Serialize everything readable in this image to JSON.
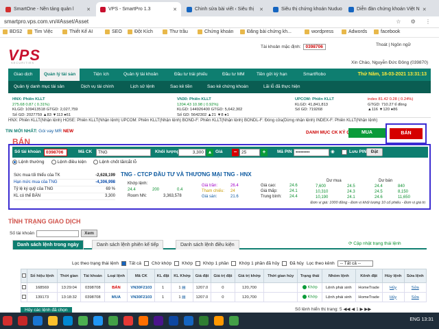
{
  "browser": {
    "tabs": [
      {
        "label": "SmartOne - Nền tảng quản l",
        "color": "#d32f2f"
      },
      {
        "label": "VPS - SmartPro 1.3",
        "color": "#c8102e"
      },
      {
        "label": "Chinh sửa bài viết ‹ Siêu thị",
        "color": "#1565c0"
      },
      {
        "label": "Siêu thị chứng khoán Nuduo",
        "color": "#1565c0"
      },
      {
        "label": "Diễn đàn chứng khoán Việt N",
        "color": "#1565c0"
      }
    ],
    "url": "smartpro.vps.com.vn/#Asset/Asset",
    "bookmarks": [
      "BDS2",
      "Tim Việc",
      "Thiết Kế AI",
      "SEO",
      "Đột Kích",
      "Thư trầu",
      "Chứng khoán",
      "Đăng bài chứng kh...",
      "wordpress",
      "Adwords",
      "facebook"
    ]
  },
  "header": {
    "logo": "VPS",
    "logo_sub": "SECURITIES",
    "account_label": "Tài khoản mặc định:",
    "account_value": "0398706",
    "links": "Thoát | Ngôn ngữ",
    "greeting": "Xin Chào, Nguyễn Đức Đông (039870)"
  },
  "menu1": {
    "items": [
      "Giao dịch",
      "Quản lý tài sản",
      "Tiện ích",
      "Quản lý tài khoản",
      "Đầu tư trái phiếu",
      "Đầu tư MM",
      "Tiền gửi kỳ hạn",
      "SmartRobo"
    ],
    "datetime": "Thứ Năm, 18-03-2021 13:31:13"
  },
  "menu2": {
    "items": [
      "Quản lý danh mục tài sản",
      "Dịch vụ tài chính",
      "Lịch sử lệnh",
      "Sao kê tiền",
      "Sao kê chứng khoán",
      "Lãi lỗ đã thực hiện"
    ]
  },
  "market": {
    "hnx": {
      "head": "HNX: Phiên KLLT",
      "l1": "275.68  0.87 ( 0.31%)",
      "l2": "KLGD: 109413518   GTGD: 2,027,759",
      "l3": "Số GD: 2027759   ▲83 ▼113 ●61"
    },
    "vn30": {
      "head": "VN30: Phiên KLLT",
      "l1": "1204.43  10.98 ( 0.92%)",
      "l2": "KLGD: 144926400   GTGD: 5,642,302",
      "l3": "Số GD: 5642302   ▲21 ▼8 ●1"
    },
    "upcom": {
      "head": "UPCOM: Phiên KLLT",
      "l1": "",
      "l2": "KLGD: 41,841,813",
      "l3": "Số GD: 719268"
    },
    "index": {
      "l1": "index 81.42  0.28 ( 0.24%)",
      "l2": "GTGD: 710.27 tỉ đồng",
      "l3": "▲116 ▼120 ●86"
    },
    "line2": "HNX: Phiên KLLT(Nhận lệnh)    HOSE: Phiên KLLT(Nhận lệnh)    UPCOM: Phiên KLLT(Nhận lệnh)    BOND-F: Phiên KLLT(Nhận lệnh)    BONDL-F: Đóng cửa(Dừng nhận lệnh)    INDEX-F: Phiên KLLT(Nhận lệnh)"
  },
  "news": {
    "label": "TIN MỚI NHẤT:",
    "text": "Gói vay MR",
    "badge": "NEW"
  },
  "order": {
    "watchlist_label": "DANH MỤC CK KÝ QUỸ",
    "buy_label": "MUA",
    "sell_label": "BÁN",
    "title": "BÁN",
    "account_label": "Số tài khoản",
    "account_value": "0398706",
    "symbol_label": "Mã CK",
    "symbol_value": "TNG",
    "qty_label": "Khối lượng",
    "qty_value": "3,300",
    "price_label": "Giá",
    "price_value": "25",
    "pin_label": "Mã PIN",
    "pin_value": "•••••••••",
    "save_pin_label": "Lưu PIN",
    "place_label": "Đặt",
    "radios": [
      "Lệnh thường",
      "Lệnh điều kiện",
      "Lệnh chốt lãi/cắt lỗ"
    ]
  },
  "summary": [
    {
      "k": "Sức mua tối thiểu của TK",
      "v": "-2,628,199"
    },
    {
      "k": "Hạn mức mua của TNG",
      "v": "-4,306,998"
    },
    {
      "k": "Tỷ lệ ký quỹ của TNG",
      "v": "69 %"
    },
    {
      "k": "KL có thể BÁN",
      "v": "3,300"
    }
  ],
  "stock": {
    "name": "TNG - CTCP ĐẦU TƯ VÀ THƯƠNG MẠI TNG - HNX",
    "room_label": "Khớp lệnh:",
    "room_v1": "24.4",
    "room_v2": "200",
    "room_v3": "0.4",
    "room_nn_label": "Room NN:",
    "room_nn_value": "3,363,578",
    "gia_tran_label": "Giá trần:",
    "gia_tran": "26.4",
    "tham_chieu_label": "Tham chiếu:",
    "tham_chieu": "24",
    "gia_san_label": "Giá sàn:",
    "gia_san": "21.6",
    "gia_cao_label": "Giá cao:",
    "gia_cao": "24.6",
    "gia_thap_label": "Giá thấp:",
    "gia_thap": "24.1",
    "tb_label": "Trung bình:",
    "tb": "24.4",
    "du_mua_label": "Dư mua",
    "du_ban_label": "Dư bán",
    "du_mua": [
      [
        "7,600",
        "24.5"
      ],
      [
        "10,310",
        "24.3"
      ],
      [
        "10,190",
        "24.1"
      ]
    ],
    "du_ban": [
      [
        "24.4",
        "840"
      ],
      [
        "24.5",
        "8,150"
      ],
      [
        "24.6",
        "11,650"
      ]
    ],
    "note": "Đơn vị giá: 1000 đồng - Đơn vị khối lượng 10 cổ phiếu - Đơn vị giá trị"
  },
  "status": {
    "title": "TÌNH TRẠNG GIAO DỊCH",
    "account_label": "Số tài khoản",
    "view_label": "Xem",
    "tabs": [
      "Danh sách lệnh trong ngày",
      "Danh sách lệnh phiên kế tiếp",
      "Danh sách lệnh điều kiện"
    ],
    "refresh": "Cập nhật trạng thái lệnh",
    "filter_label": "Lọc theo trạng thái lệnh",
    "filters": [
      {
        "label": "Tất cả",
        "on": true
      },
      {
        "label": "Chờ khớp",
        "on": false
      },
      {
        "label": "Khớp",
        "on": false
      },
      {
        "label": "Khớp 1 phần",
        "on": false
      },
      {
        "label": "Khớp 1 phần đã hủy",
        "on": false
      },
      {
        "label": "Đã hủy",
        "on": false
      }
    ],
    "kenh_label": "Lọc theo kênh",
    "kenh_value": "-- Tất cả --",
    "headers": [
      "",
      "Số hiệu lệnh",
      "Thời gian",
      "Tài khoản",
      "Loại lệnh",
      "Mã CK",
      "KL đặt",
      "KL Khớp",
      "Giá đặt",
      "Giá trị đặt",
      "Giá trị khớp",
      "Thời gian hủy",
      "Trạng thái",
      "Nhóm lệnh",
      "Kênh đặt",
      "Hủy lệnh",
      "Sửa lệnh"
    ],
    "rows": [
      [
        "",
        "168569",
        "13:29:04",
        "0398708",
        "BÁN",
        "VN30F2103",
        "1",
        "1",
        "1207.0",
        "0",
        "120,700",
        "",
        "Khớp",
        "Lệnh phái sinh",
        "HomeTrade",
        "Hủy",
        "Sửa"
      ],
      [
        "",
        "139173",
        "13:18:32",
        "0398708",
        "MUA",
        "VN30F2103",
        "1",
        "1",
        "1207.0",
        "0",
        "120,700",
        "",
        "Khớp",
        "Lệnh phái sinh",
        "HomeTrade",
        "Hủy",
        "Sửa"
      ]
    ],
    "cancel_all": "Hủy các lệnh đã chọn",
    "rows_per_page": "Số lệnh hiển thị trang: 5  ◀◀ ◀ 1 ▶ ▶▶"
  },
  "taskbar": {
    "time": "13:31",
    "lang": "ENG"
  }
}
